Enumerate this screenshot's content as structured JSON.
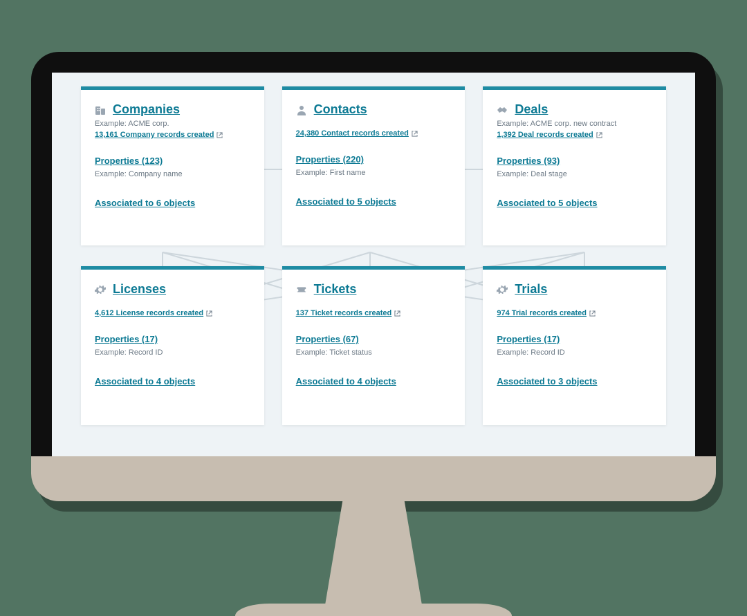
{
  "colors": {
    "accent": "#1e8ba3",
    "text_muted": "#6b7884",
    "link": "#0d7a94"
  },
  "cards": [
    {
      "id": "companies",
      "icon": "building-icon",
      "title": "Companies",
      "example": "Example: ACME corp.",
      "records_link": "13,161 Company records created",
      "properties_link": "Properties (123)",
      "properties_example": "Example: Company name",
      "associated_link": "Associated to 6 objects"
    },
    {
      "id": "contacts",
      "icon": "person-icon",
      "title": "Contacts",
      "example": "",
      "records_link": "24,380 Contact records created",
      "properties_link": "Properties (220)",
      "properties_example": "Example: First name",
      "associated_link": "Associated to 5 objects"
    },
    {
      "id": "deals",
      "icon": "handshake-icon",
      "title": "Deals",
      "example": "Example: ACME corp. new contract",
      "records_link": "1,392 Deal records created",
      "properties_link": "Properties (93)",
      "properties_example": "Example: Deal stage",
      "associated_link": "Associated to 5 objects"
    },
    {
      "id": "licenses",
      "icon": "gear-icon",
      "title": "Licenses",
      "example": "",
      "records_link": "4,612 License records created",
      "properties_link": "Properties (17)",
      "properties_example": "Example: Record ID",
      "associated_link": "Associated to 4 objects"
    },
    {
      "id": "tickets",
      "icon": "ticket-icon",
      "title": "Tickets",
      "example": "",
      "records_link": "137 Ticket records created",
      "properties_link": "Properties (67)",
      "properties_example": "Example: Ticket status",
      "associated_link": "Associated to 4 objects"
    },
    {
      "id": "trials",
      "icon": "gear-icon",
      "title": "Trials",
      "example": "",
      "records_link": "974 Trial records created",
      "properties_link": "Properties (17)",
      "properties_example": "Example: Record ID",
      "associated_link": "Associated to 3 objects"
    }
  ]
}
